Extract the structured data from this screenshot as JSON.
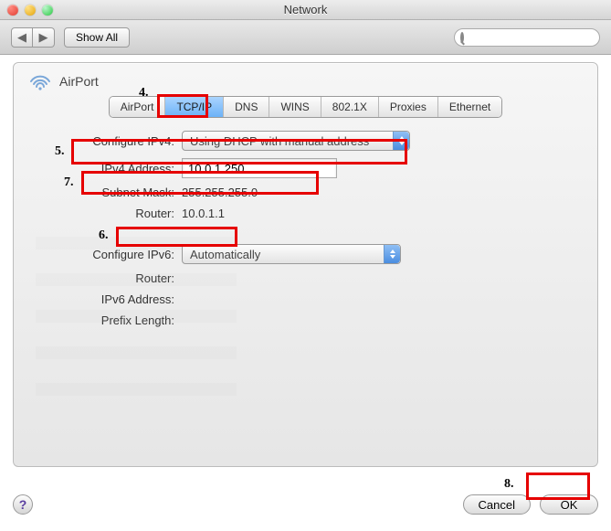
{
  "window": {
    "title": "Network"
  },
  "toolbar": {
    "show_all": "Show All",
    "search_placeholder": ""
  },
  "pane": {
    "service_name": "AirPort",
    "tabs": [
      "AirPort",
      "TCP/IP",
      "DNS",
      "WINS",
      "802.1X",
      "Proxies",
      "Ethernet"
    ],
    "active_tab_index": 1
  },
  "tcpip": {
    "configure_ipv4_label": "Configure IPv4:",
    "configure_ipv4_value": "Using DHCP with manual address",
    "ipv4_address_label": "IPv4 Address:",
    "ipv4_address_value": "10.0.1.250",
    "subnet_mask_label": "Subnet Mask:",
    "subnet_mask_value": "255.255.255.0",
    "router_label": "Router:",
    "router_value": "10.0.1.1",
    "configure_ipv6_label": "Configure IPv6:",
    "configure_ipv6_value": "Automatically",
    "router6_label": "Router:",
    "router6_value": "",
    "ipv6_address_label": "IPv6 Address:",
    "ipv6_address_value": "",
    "prefix_length_label": "Prefix Length:",
    "prefix_length_value": ""
  },
  "footer": {
    "cancel": "Cancel",
    "ok": "OK"
  },
  "annotations": {
    "n4": "4.",
    "n5": "5.",
    "n6": "6.",
    "n7": "7.",
    "n8": "8."
  }
}
